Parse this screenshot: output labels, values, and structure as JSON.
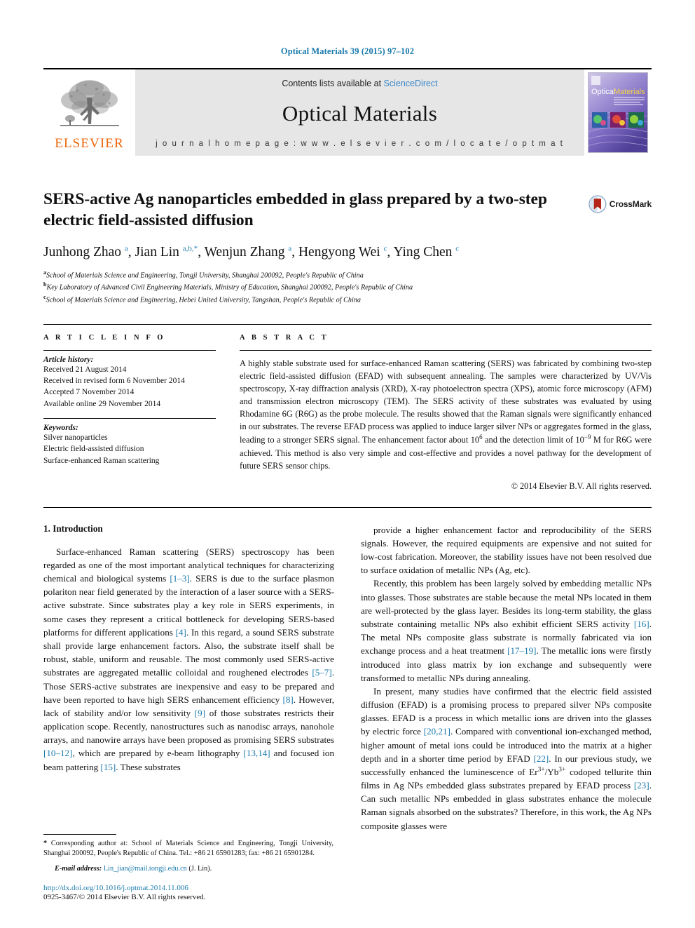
{
  "running_head": "Optical Materials 39 (2015) 97–102",
  "masthead": {
    "publisher_logo_word": "ELSEVIER",
    "contents_prefix": "Contents lists available at ",
    "contents_link": "ScienceDirect",
    "journal_name": "Optical Materials",
    "homepage_line": "j o u r n a l   h o m e p a g e :   w w w . e l s e v i e r . c o m / l o c a t e / o p t m a t",
    "cover_title_left": "Optical",
    "cover_title_right": "Materials"
  },
  "article": {
    "title": "SERS-active Ag nanoparticles embedded in glass prepared by a two-step electric field-assisted diffusion",
    "crossmark_label": "CrossMark",
    "authors_html": "Junhong Zhao <sup>a</sup>, Jian Lin <sup>a,b,</sup><sup>*</sup>, Wenjun Zhang <sup>a</sup>, Hengyong Wei <sup>c</sup>, Ying Chen <sup>c</sup>",
    "affiliations": [
      {
        "marker": "a",
        "text": "School of Materials Science and Engineering, Tongji University, Shanghai 200092, People's Republic of China"
      },
      {
        "marker": "b",
        "text": "Key Laboratory of Advanced Civil Engineering Materials, Ministry of Education, Shanghai 200092, People's Republic of China"
      },
      {
        "marker": "c",
        "text": "School of Materials Science and Engineering, Hebei United University, Tangshan, People's Republic of China"
      }
    ]
  },
  "article_info": {
    "eyebrow": "A R T I C L E   I N F O",
    "history_label": "Article history:",
    "history": [
      "Received 21 August 2014",
      "Received in revised form 6 November 2014",
      "Accepted 7 November 2014",
      "Available online 29 November 2014"
    ],
    "keywords_label": "Keywords:",
    "keywords": [
      "Silver nanoparticles",
      "Electric field-assisted diffusion",
      "Surface-enhanced Raman scattering"
    ]
  },
  "abstract": {
    "eyebrow": "A B S T R A C T",
    "text_html": "A highly stable substrate used for surface-enhanced Raman scattering (SERS) was fabricated by combining two-step electric field-assisted diffusion (EFAD) with subsequent annealing. The samples were characterized by UV/Vis spectroscopy, X-ray diffraction analysis (XRD), X-ray photoelectron spectra (XPS), atomic force microscopy (AFM) and transmission electron microscopy (TEM). The SERS activity of these substrates was evaluated by using Rhodamine 6G (R6G) as the probe molecule. The results showed that the Raman signals were significantly enhanced in our substrates. The reverse EFAD process was applied to induce larger silver NPs or aggregates formed in the glass, leading to a stronger SERS signal. The enhancement factor about 10<sup class=\"supsm\">6</sup> and the detection limit of 10<sup class=\"supsm\">−9</sup> M for R6G were achieved. This method is also very simple and cost-effective and provides a novel pathway for the development of future SERS sensor chips.",
    "copyright": "© 2014 Elsevier B.V. All rights reserved."
  },
  "body": {
    "section_heading": "1. Introduction",
    "left_paragraph_html": "Surface-enhanced Raman scattering (SERS) spectroscopy has been regarded as one of the most important analytical techniques for characterizing chemical and biological systems <span class=\"ref\">[1–3]</span>. SERS is due to the surface plasmon polariton near field generated by the interaction of a laser source with a SERS-active substrate. Since substrates play a key role in SERS experiments, in some cases they represent a critical bottleneck for developing SERS-based platforms for different applications <span class=\"ref\">[4]</span>. In this regard, a sound SERS substrate shall provide large enhancement factors. Also, the substrate itself shall be robust, stable, uniform and reusable. The most commonly used SERS-active substrates are aggregated metallic colloidal and roughened electrodes <span class=\"ref\">[5–7]</span>. Those SERS-active substrates are inexpensive and easy to be prepared and have been reported to have high SERS enhancement efficiency <span class=\"ref\">[8]</span>. However, lack of stability and/or low sensitivity <span class=\"ref\">[9]</span> of those substrates restricts their application scope. Recently, nanostructures such as nanodisc arrays, nanohole arrays, and nanowire arrays have been proposed as promising SERS substrates <span class=\"ref\">[10–12]</span>, which are prepared by e-beam lithography <span class=\"ref\">[13,14]</span> and focused ion beam pattering <span class=\"ref\">[15]</span>. These substrates",
    "right_paragraph_1_html": "provide a higher enhancement factor and reproducibility of the SERS signals. However, the required equipments are expensive and not suited for low-cost fabrication. Moreover, the stability issues have not been resolved due to surface oxidation of metallic NPs (Ag, etc).",
    "right_paragraph_2_html": "Recently, this problem has been largely solved by embedding metallic NPs into glasses. Those substrates are stable because the metal NPs located in them are well-protected by the glass layer. Besides its long-term stability, the glass substrate containing metallic NPs also exhibit efficient SERS activity <span class=\"ref\">[16]</span>. The metal NPs composite glass substrate is normally fabricated via ion exchange process and a heat treatment <span class=\"ref\">[17–19]</span>. The metallic ions were firstly introduced into glass matrix by ion exchange and subsequently were transformed to metallic NPs during annealing.",
    "right_paragraph_3_html": "In present, many studies have confirmed that the electric field assisted diffusion (EFAD) is a promising process to prepared silver NPs composite glasses. EFAD is a process in which metallic ions are driven into the glasses by electric force <span class=\"ref\">[20,21]</span>. Compared with conventional ion-exchanged method, higher amount of metal ions could be introduced into the matrix at a higher depth and in a shorter time period by EFAD <span class=\"ref\">[22]</span>. In our previous study, we successfully enhanced the luminescence of Er<sup class=\"supsm\">3+</sup>/Yb<sup class=\"supsm\">3+</sup> codoped tellurite thin films in Ag NPs embedded glass substrates prepared by EFAD process <span class=\"ref\">[23]</span>. Can such metallic NPs embedded in glass substrates enhance the molecule Raman signals absorbed on the substrates? Therefore, in this work, the Ag NPs composite glasses were"
  },
  "footer": {
    "corresponding_html": "<b>*</b> Corresponding author at: School of Materials Science and Engineering, Tongji University, Shanghai 200092, People's Republic of China. Tel.: +86 21 65901283; fax: +86 21 65901284.",
    "email_label": "E-mail address:",
    "email": "Lin_jian@mail.tongji.edu.cn",
    "email_suffix": "(J. Lin).",
    "doi": "http://dx.doi.org/10.1016/j.optmat.2014.11.006",
    "issn_line": "0925-3467/© 2014 Elsevier B.V. All rights reserved."
  },
  "colors": {
    "link_blue": "#1a7aad",
    "elsevier_orange": "#ec6608",
    "sciencedirect_blue": "#3a87c8",
    "crossmark_red": "#b4261a"
  }
}
